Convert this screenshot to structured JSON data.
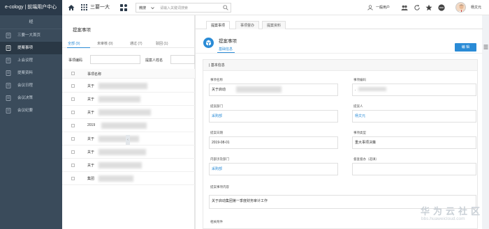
{
  "header": {
    "brand": "e-cology | 前端用户中心",
    "app_name": "三要一大",
    "search_type": "微搜",
    "search_placeholder": "请输入关键词搜索",
    "user_role": "一般用户",
    "username": "杨文元"
  },
  "sidebar": {
    "top_label": "经",
    "items": [
      {
        "label": "三要一大首页",
        "active": false
      },
      {
        "label": "提案事项",
        "active": true
      },
      {
        "label": "上会议程",
        "active": false
      },
      {
        "label": "提案资料",
        "active": false
      },
      {
        "label": "会议日程",
        "active": false
      },
      {
        "label": "会议决策",
        "active": false
      },
      {
        "label": "会议纪要",
        "active": false
      }
    ]
  },
  "list_panel": {
    "title": "提案事项",
    "tabs": [
      "全部 (9)",
      "未审核 (0)",
      "通过 (7)",
      "驳回 (1)"
    ],
    "filter_labels": {
      "code": "事项编码",
      "proposer": "提案人姓名"
    },
    "column_header": "事项名称",
    "rows": [
      "关于",
      "关于",
      "关于",
      "2019",
      "关于",
      "关于",
      "关于",
      "集团"
    ]
  },
  "detail": {
    "tabs": [
      "提案事项",
      "事项督办",
      "提案资料"
    ],
    "title": "提案事项",
    "subtab": "基础信息",
    "edit_label": "编 辑",
    "section_header": "| 基本信息",
    "fields": {
      "name_label": "事项名称",
      "name_value": "关于启动",
      "code_label": "事项编码",
      "code_value": ".",
      "dept_label": "提案部门",
      "dept_value": "采购部",
      "proposer_label": "提案人",
      "proposer_value": "杨文元",
      "date_label": "提案日期",
      "date_value": "2019-08-01",
      "type_label": "事项类型",
      "type_value": "重大事项决策",
      "inner_dept_label": "内部涉及部门",
      "inner_dept_value": "采购部",
      "supervise_label": "督查督办（选填）",
      "supervise_value": "",
      "content_label": "提案事项内容",
      "content_value": "关于启动集团第一季度财务审计工作",
      "attach_label": "相关附件"
    }
  },
  "watermark": {
    "text": "华为云社区",
    "url": "bbs.huaweicloud.com"
  },
  "colors": {
    "accent": "#2a8bd6",
    "sidebar": "#3a4b5b",
    "brand_bar": "#2b3a4a"
  }
}
